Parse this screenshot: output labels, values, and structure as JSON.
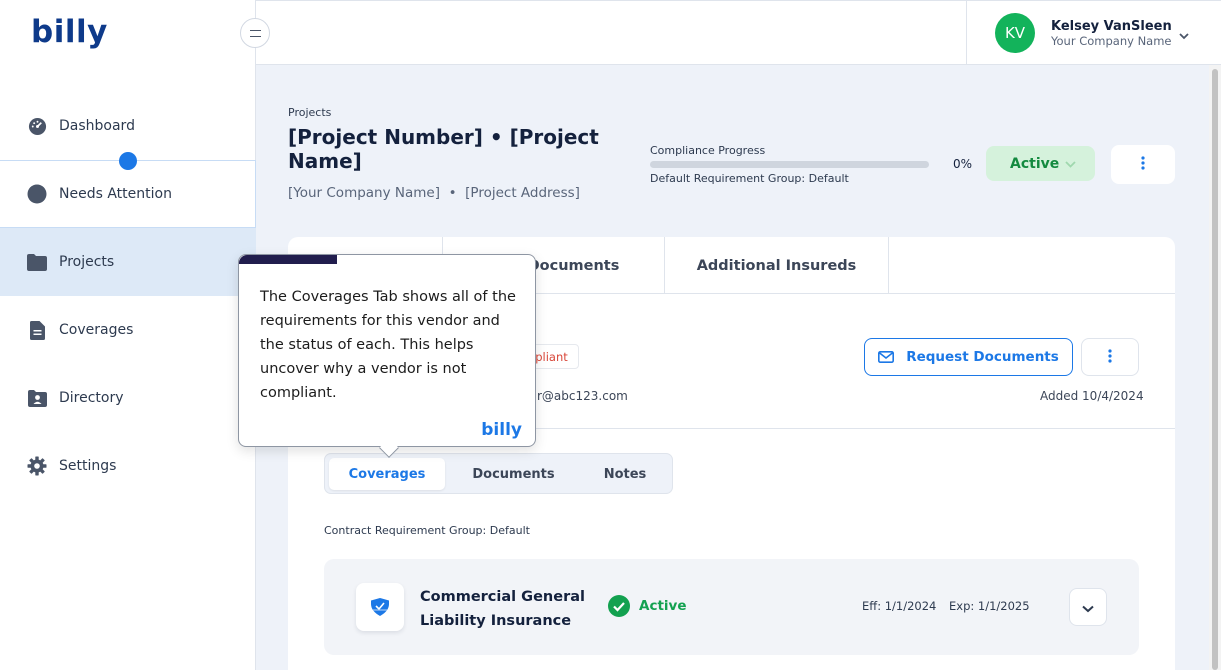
{
  "brand": {
    "logo": "billy",
    "accent": "#1c78e6",
    "success": "#13b35b"
  },
  "sidebar": {
    "items": [
      {
        "label": "Dashboard",
        "icon": "gauge-icon"
      },
      {
        "label": "Needs Attention",
        "icon": "circle-icon"
      },
      {
        "label": "Projects",
        "icon": "folder-icon",
        "active": true
      },
      {
        "label": "Coverages",
        "icon": "document-icon"
      },
      {
        "label": "Directory",
        "icon": "contact-folder-icon"
      },
      {
        "label": "Settings",
        "icon": "gear-icon"
      }
    ]
  },
  "user": {
    "initials": "KV",
    "name": "Kelsey VanSleen",
    "company": "Your Company Name"
  },
  "project": {
    "breadcrumb": "Projects",
    "title": "[Project Number] • [Project Name]",
    "company": "[Your Company Name]",
    "separator": "•",
    "address": "[Project Address]",
    "compliance_label": "Compliance Progress",
    "compliance_percent": "0%",
    "compliance_value": 0,
    "default_group": "Default Requirement Group: Default",
    "status": "Active"
  },
  "tabs": [
    "Documents",
    "Additional Insureds"
  ],
  "vendor": {
    "badge": "mpliant",
    "email": "r@abc123.com",
    "request_button": "Request Documents",
    "added": "Added 10/4/2024"
  },
  "subtabs": [
    "Coverages",
    "Documents",
    "Notes"
  ],
  "contract_group": "Contract Requirement Group: Default",
  "coverage": {
    "name": "Commercial General Liability Insurance",
    "status": "Active",
    "eff": "Eff: 1/1/2024",
    "exp": "Exp: 1/1/2025"
  },
  "tooltip": {
    "text": "The Coverages Tab shows all of the requirements for this vendor and the status of each. This helps uncover why a vendor is not compliant.",
    "logo": "billy",
    "progress": 0.33
  }
}
